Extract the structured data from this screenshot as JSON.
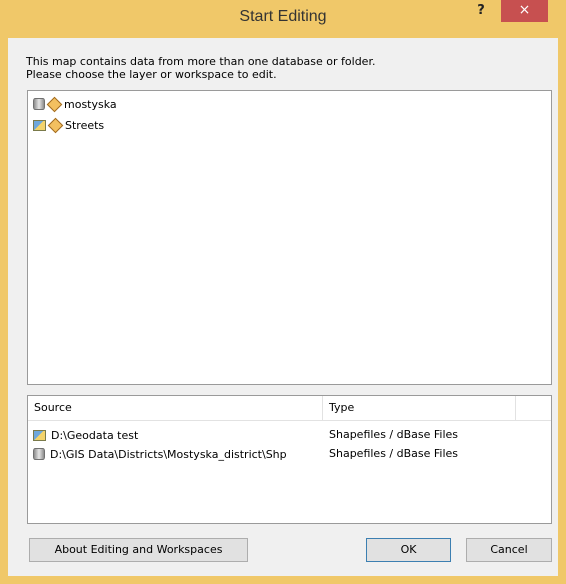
{
  "window": {
    "title": "Start Editing",
    "help_label": "?",
    "close_label": "×"
  },
  "prompt": {
    "line1": "This map contains data from more than one database or folder.",
    "line2": "Please choose the layer or workspace to edit."
  },
  "layers": [
    {
      "label": "mostyska",
      "workspace_icon": "database-icon"
    },
    {
      "label": "Streets",
      "workspace_icon": "folder-icon"
    }
  ],
  "sources": {
    "columns": [
      "Source",
      "Type"
    ],
    "rows": [
      {
        "source": "D:\\Geodata test",
        "type": "Shapefiles / dBase Files",
        "icon": "folder-icon"
      },
      {
        "source": "D:\\GIS Data\\Districts\\Mostyska_district\\Shp",
        "type": "Shapefiles / dBase Files",
        "icon": "database-icon"
      }
    ]
  },
  "buttons": {
    "about_label": "About Editing and Workspaces",
    "ok_label": "OK",
    "cancel_label": "Cancel"
  }
}
